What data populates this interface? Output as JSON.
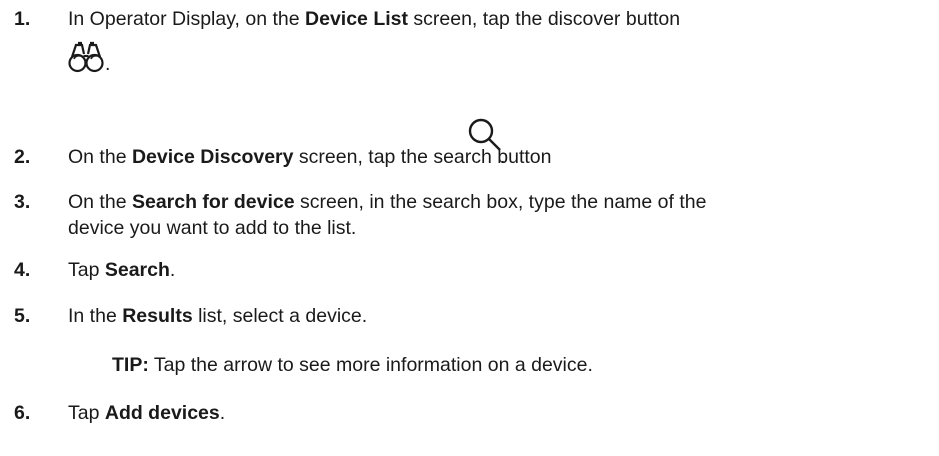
{
  "steps": [
    {
      "number": "1.",
      "parts": [
        "In Operator Display, on the ",
        "Device List",
        " screen, tap the discover button",
        "."
      ],
      "icon": "binoculars-icon"
    },
    {
      "number": "2.",
      "parts": [
        "On the ",
        "Device Discovery",
        " screen, tap the search button",
        "."
      ],
      "icon": "search-icon"
    },
    {
      "number": "3.",
      "parts": [
        "On the ",
        "Search for device",
        " screen, in the search box, type the name of the",
        "device you want to add to the list."
      ]
    },
    {
      "number": "4.",
      "parts": [
        "Tap ",
        "Search",
        "."
      ]
    },
    {
      "number": "5.",
      "parts": [
        "In the ",
        "Results",
        " list, select a device."
      ]
    },
    {
      "number": "6.",
      "parts": [
        "Tap ",
        "Add devices",
        "."
      ]
    }
  ],
  "tip": {
    "label": "TIP:",
    "text": " Tap the arrow to see more information on a device."
  }
}
